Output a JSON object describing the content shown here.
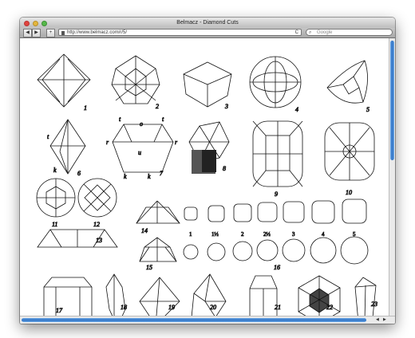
{
  "window": {
    "title": "Belmacz - Diamond Cuts"
  },
  "toolbar": {
    "back_glyph": "◀",
    "forward_glyph": "▶",
    "add_glyph": "+",
    "url": "http://www.belmacz.com/r/5/",
    "reload_glyph": "C",
    "search_placeholder": "Google"
  },
  "plate": {
    "figure_labels": [
      "1",
      "2",
      "3",
      "4",
      "5",
      "6",
      "7",
      "8",
      "9",
      "10",
      "11",
      "12",
      "13",
      "14",
      "15",
      "16",
      "17",
      "18",
      "19",
      "20",
      "21",
      "22",
      "23"
    ],
    "facet_letters": [
      "t",
      "o",
      "t",
      "r",
      "u",
      "r",
      "k",
      "k",
      "t",
      "k"
    ],
    "size_labels": [
      "1",
      "1½",
      "2",
      "2½",
      "3",
      "4",
      "5"
    ]
  },
  "colors": {
    "ink": "#111111",
    "scroll_thumb": "#2f72c4"
  }
}
